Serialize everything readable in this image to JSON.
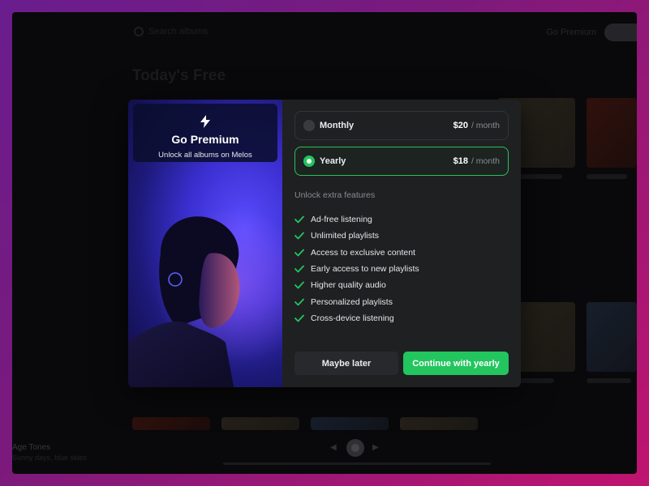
{
  "background_app": {
    "search_placeholder": "Search albums",
    "top_right_text": "Go Premium",
    "section_title": "Today's Free",
    "now_playing_title": "Age Tones",
    "now_playing_sub": "Sunny days, blue skies"
  },
  "modal": {
    "promo": {
      "icon": "bolt-icon",
      "title": "Go Premium",
      "subtitle": "Unlock all albums on Melos"
    },
    "plans": [
      {
        "name": "Monthly",
        "price": "$20",
        "unit": "/ month",
        "selected": false
      },
      {
        "name": "Yearly",
        "price": "$18",
        "unit": "/ month",
        "selected": true
      }
    ],
    "features_heading": "Unlock extra features",
    "features": [
      "Ad-free listening",
      "Unlimited playlists",
      "Access to exclusive content",
      "Early access to new playlists",
      "Higher quality audio",
      "Personalized playlists",
      "Cross-device listening"
    ],
    "buttons": {
      "later": "Maybe later",
      "continue": "Continue with yearly"
    }
  },
  "colors": {
    "accent_green": "#22c55e",
    "modal_bg": "#1f2022",
    "check_green": "#22c55e"
  }
}
